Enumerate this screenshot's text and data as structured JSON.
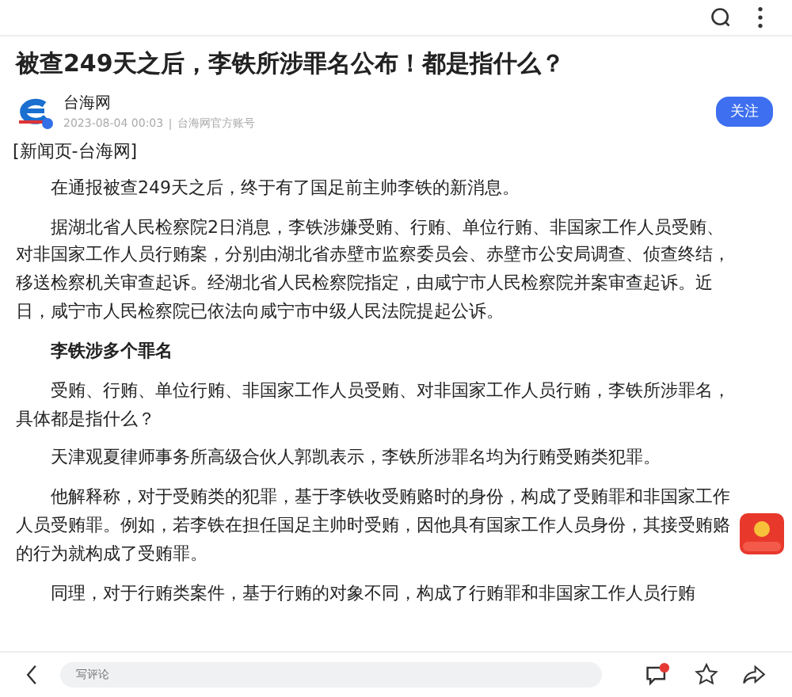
{
  "title": "被查249天之后，李铁所涉罪名公布！都是指什么？",
  "author": {
    "name": "台海网",
    "date": "2023-08-04 00:03",
    "account": "台海网官方账号",
    "verified": true
  },
  "follow_button": "关注",
  "source": "[新闻页-台海网]",
  "paragraphs": [
    {
      "kind": "text",
      "text": "在通报被查249天之后，终于有了国足前主帅李铁的新消息。"
    },
    {
      "kind": "text",
      "text": "据湖北省人民检察院2日消息，李铁涉嫌受贿、行贿、单位行贿、非国家工作人员受贿、对非国家工作人员行贿案，分别由湖北省赤壁市监察委员会、赤壁市公安局调查、侦查终结，移送检察机关审查起诉。经湖北省人民检察院指定，由咸宁市人民检察院并案审查起诉。近日，咸宁市人民检察院已依法向咸宁市中级人民法院提起公诉。"
    },
    {
      "kind": "heading",
      "text": "李铁涉多个罪名"
    },
    {
      "kind": "text",
      "text": "受贿、行贿、单位行贿、非国家工作人员受贿、对非国家工作人员行贿，李铁所涉罪名，具体都是指什么？"
    },
    {
      "kind": "text",
      "text": "天津观夏律师事务所高级合伙人郭凯表示，李铁所涉罪名均为行贿受贿类犯罪。"
    },
    {
      "kind": "text",
      "text": "他解释称，对于受贿类的犯罪，基于李铁收受贿赂时的身份，构成了受贿罪和非国家工作人员受贿罪。例如，若李铁在担任国足主帅时受贿，因他具有国家工作人员身份，其接受贿赂的行为就构成了受贿罪。"
    },
    {
      "kind": "text",
      "text": "同理，对于行贿类案件，基于行贿的对象不同，构成了行贿罪和非国家工作人员行贿"
    }
  ],
  "comment": {
    "placeholder": "写评论",
    "unread": true
  }
}
